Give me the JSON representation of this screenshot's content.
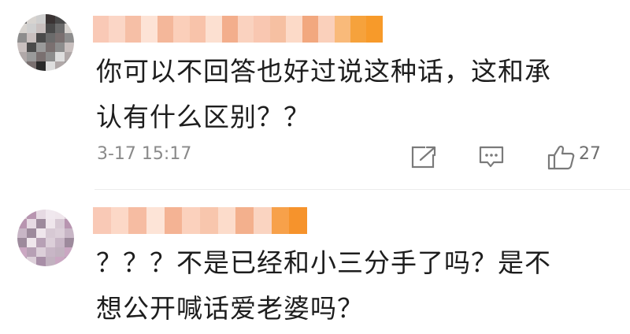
{
  "comments": [
    {
      "text": "你可以不回答也好过说这种话，这和承\n认有什么区别？？",
      "time": "3-17 15:17",
      "likes": "27",
      "avatar_colors": [
        "#6b6b6b",
        "#9a9a9a",
        "#cfcfcf",
        "#8d8d8d",
        "#2a2a2a",
        "#4a4a4a",
        "#b0a8a8",
        "#d8d4d0",
        "#7a7070",
        "#3a3333",
        "#c9c0bf",
        "#dedede"
      ],
      "name_colors": [
        "#f9c9b6",
        "#fbd6c6",
        "#f6bfa6",
        "#fde3d6",
        "#f4b79a",
        "#fbcfba",
        "#f8c3aa",
        "#fce0d1",
        "#f3ae8c",
        "#fad2bf",
        "#f9c7b1",
        "#f6c0a2",
        "#fcdac8",
        "#f2a87f",
        "#fad0bb",
        "#f9ba7a",
        "#f6a23c",
        "#f79a2a"
      ]
    },
    {
      "text": "？？？不是已经和小三分手了吗？是不\n想公开喊话爱老婆吗？",
      "avatar_colors": [
        "#d7c9d4",
        "#b7a0b5",
        "#e6dae3",
        "#c8b6c6",
        "#a88ea7",
        "#efe6ec",
        "#caa7c2",
        "#b895b0",
        "#dccfd9",
        "#f0e8ee",
        "#9d8a9c",
        "#c2b2c0"
      ],
      "name_colors": [
        "#f9c9b6",
        "#fcd8c7",
        "#f6bca2",
        "#fde4d7",
        "#f4b394",
        "#fbd1bd",
        "#f8c6ad",
        "#fcdccb",
        "#f3b08d",
        "#fad4c1",
        "#f7a14a",
        "#f6932c"
      ]
    }
  ],
  "icons": {
    "share": "share-icon",
    "comment": "comment-icon",
    "like": "thumbs-up-icon"
  },
  "colors": {
    "meta": "#8a8a8a",
    "icon": "#7a7a7a",
    "divider": "#ececec"
  }
}
